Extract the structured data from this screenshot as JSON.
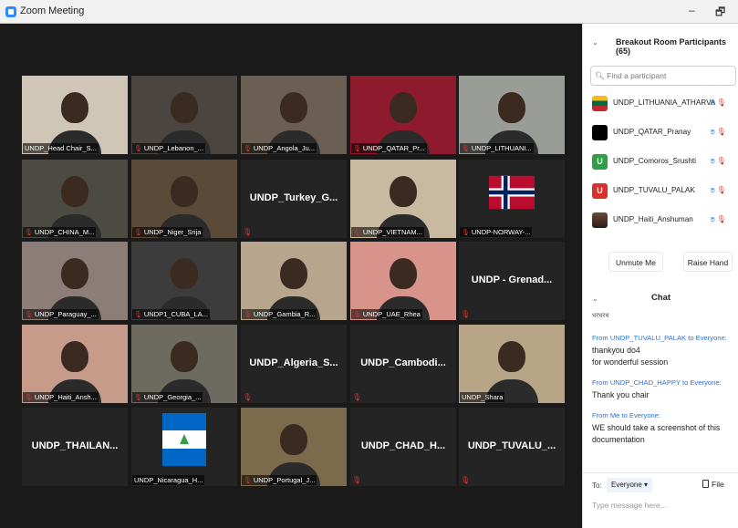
{
  "window": {
    "title": "Zoom Meeting",
    "minimize": "–",
    "restore": "🗗"
  },
  "tiles": [
    {
      "name": "UNDP_Head Chair_S...",
      "type": "video",
      "active": true,
      "muted": false,
      "bg": "#cfc6b8"
    },
    {
      "name": "UNDP_Lebanon_...",
      "type": "video",
      "muted": true,
      "bg": "#4a4540"
    },
    {
      "name": "UNDP_Angola_Ju...",
      "type": "video",
      "muted": true,
      "bg": "#6b5e52"
    },
    {
      "name": "UNDP_QATAR_Pr...",
      "type": "video",
      "muted": true,
      "bg": "#8e1b2d"
    },
    {
      "name": "UNDP_LITHUANI...",
      "type": "video",
      "muted": true,
      "bg": "#9a9c98"
    },
    {
      "name": "UNDP_CHINA_M...",
      "type": "video",
      "muted": true,
      "bg": "#4c4b43"
    },
    {
      "name": "UNDP_Niger_Srija",
      "type": "video",
      "muted": true,
      "bg": "#5b4a38"
    },
    {
      "name": "UNDP_Turkey_G...",
      "type": "name",
      "muted": true
    },
    {
      "name": "UNDP_VIETNAM...",
      "type": "video",
      "muted": true,
      "bg": "#c9b9a1"
    },
    {
      "name": "UNDP-NORWAY-...",
      "type": "flag-norway",
      "muted": true
    },
    {
      "name": "UNDP_Paraguay_...",
      "type": "video",
      "muted": true,
      "bg": "#8d7d78"
    },
    {
      "name": "UNDP1_CUBA_LA...",
      "type": "video",
      "muted": true,
      "bg": "#3c3c3c"
    },
    {
      "name": "UNDP_Gambia_R...",
      "type": "video",
      "muted": true,
      "bg": "#b7a68d"
    },
    {
      "name": "UNDP_UAE_Rhea",
      "type": "video",
      "muted": true,
      "bg": "#d8938a"
    },
    {
      "name": "UNDP - Grenad...",
      "type": "name",
      "muted": true
    },
    {
      "name": "UNDP_Haiti_Ansh...",
      "type": "video",
      "muted": true,
      "bg": "#c69b8a"
    },
    {
      "name": "UNDP_Georgia_...",
      "type": "video",
      "muted": true,
      "bg": "#6d6a60"
    },
    {
      "name": "UNDP_Algeria_S...",
      "type": "name",
      "muted": true
    },
    {
      "name": "UNDP_Cambodi...",
      "type": "name",
      "muted": true
    },
    {
      "name": "UNDP_Shara",
      "type": "video",
      "muted": false,
      "bg": "#b8a487"
    },
    {
      "name": "UNDP_THAILAN...",
      "type": "name-only"
    },
    {
      "name": "UNDP_Nicaragua_H...",
      "type": "flag-nicaragua",
      "muted": false
    },
    {
      "name": "UNDP_Portugal_J...",
      "type": "video",
      "muted": true,
      "bg": "#7b6a4c"
    },
    {
      "name": "UNDP_CHAD_H...",
      "type": "name",
      "muted": true
    },
    {
      "name": "UNDP_TUVALU_...",
      "type": "name",
      "muted": true
    }
  ],
  "panel": {
    "participants_title": "Breakout Room Participants (65)",
    "search_placeholder": "Find a participant",
    "participants": [
      {
        "name": "UNDP_LITHUANIA_ATHARVA",
        "avatar": "",
        "avatar_style": "lithuania"
      },
      {
        "name": "UNDP_QATAR_Pranay",
        "avatar": "",
        "avatar_style": "black"
      },
      {
        "name": "UNDP_Comoros_Srushti",
        "avatar": "U",
        "avatar_style": "green"
      },
      {
        "name": "UNDP_TUVALU_PALAK",
        "avatar": "U",
        "avatar_style": "red"
      },
      {
        "name": "UNDP_Haiti_Anshuman",
        "avatar": "",
        "avatar_style": "photo"
      }
    ],
    "unmute_label": "Unmute Me",
    "raise_hand_label": "Raise Hand",
    "chat_title": "Chat",
    "chat_cutoff": "धरधरध",
    "messages": [
      {
        "from": "From UNDP_TUVALU_PALAK to Everyone:",
        "lines": [
          "thankyou do4",
          "for wonderful session"
        ]
      },
      {
        "from": "From UNDP_CHAD_HAPPY to Everyone:",
        "lines": [
          "Thank you chair"
        ]
      },
      {
        "from": "From Me to Everyone:",
        "lines": [
          "WE should take a screenshot of this",
          "documentation"
        ]
      }
    ],
    "to_label": "To:",
    "to_value": "Everyone ▾",
    "file_label": "File",
    "input_placeholder": "Type message here..."
  },
  "colors": {
    "active_speaker": "#e4d24b",
    "muted_red": "#e0302c",
    "link_blue": "#2d6fd6"
  }
}
